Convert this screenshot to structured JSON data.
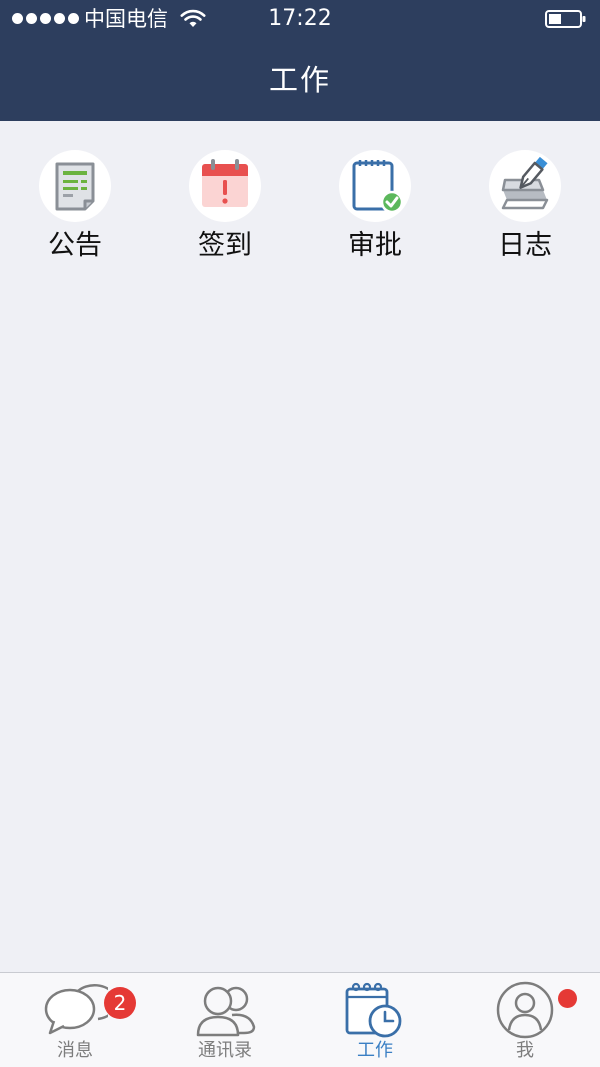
{
  "status_bar": {
    "carrier": "中国电信",
    "time": "17:22",
    "icons": [
      "signal-dots-icon",
      "wifi-icon",
      "battery-icon"
    ]
  },
  "nav": {
    "title": "工作"
  },
  "apps": [
    {
      "label": "公告",
      "icon": "announcement-icon"
    },
    {
      "label": "签到",
      "icon": "calendar-checkin-icon"
    },
    {
      "label": "审批",
      "icon": "approval-notebook-icon"
    },
    {
      "label": "日志",
      "icon": "pen-log-icon"
    }
  ],
  "tabbar": {
    "tabs": [
      {
        "label": "消息",
        "icon": "chat-bubbles-icon",
        "badge": "2",
        "active": false
      },
      {
        "label": "通讯录",
        "icon": "contacts-icon",
        "active": false
      },
      {
        "label": "工作",
        "icon": "work-calendar-clock-icon",
        "active": true
      },
      {
        "label": "我",
        "icon": "profile-icon",
        "active": false,
        "dot": true
      }
    ]
  },
  "colors": {
    "header_bg": "#2d3e5e",
    "page_bg": "#eff0f5",
    "active_tab": "#3a7fc4",
    "badge": "#e53935",
    "approval_check": "#5cb85c",
    "checkin_red": "#e8504f"
  }
}
